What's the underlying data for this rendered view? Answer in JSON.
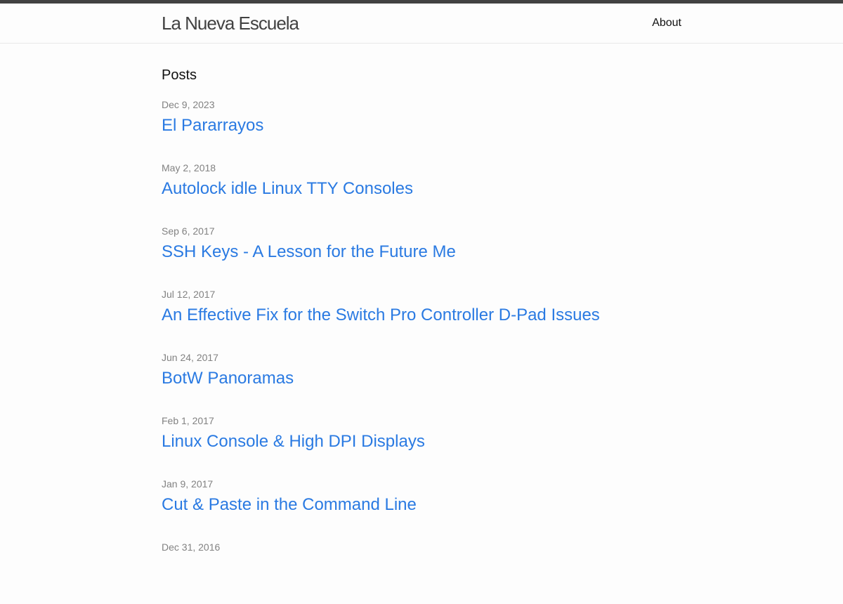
{
  "header": {
    "site_title": "La Nueva Escuela",
    "nav": [
      {
        "label": "About"
      }
    ]
  },
  "main": {
    "heading": "Posts",
    "posts": [
      {
        "date": "Dec 9, 2023",
        "title": "El Pararrayos"
      },
      {
        "date": "May 2, 2018",
        "title": "Autolock idle Linux TTY Consoles"
      },
      {
        "date": "Sep 6, 2017",
        "title": "SSH Keys - A Lesson for the Future Me"
      },
      {
        "date": "Jul 12, 2017",
        "title": "An Effective Fix for the Switch Pro Controller D-Pad Issues"
      },
      {
        "date": "Jun 24, 2017",
        "title": "BotW Panoramas"
      },
      {
        "date": "Feb 1, 2017",
        "title": "Linux Console & High DPI Displays"
      },
      {
        "date": "Jan 9, 2017",
        "title": "Cut & Paste in the Command Line"
      },
      {
        "date": "Dec 31, 2016",
        "title": ""
      }
    ]
  },
  "colors": {
    "top_bar": "#424242",
    "link": "#2a7ae2",
    "meta": "#828282",
    "background": "#fdfdfd"
  }
}
